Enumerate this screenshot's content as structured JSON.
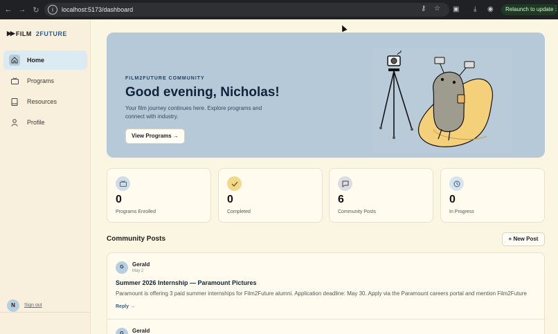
{
  "browser": {
    "url": "localhost:5173/dashboard",
    "relaunch_label": "Relaunch to update"
  },
  "sidebar": {
    "logo_left": "FILM",
    "logo_right": "2FUTURE",
    "items": [
      {
        "label": "Home",
        "icon": "home-icon",
        "active": true
      },
      {
        "label": "Programs",
        "icon": "tv-icon",
        "active": false
      },
      {
        "label": "Resources",
        "icon": "book-icon",
        "active": false
      },
      {
        "label": "Profile",
        "icon": "person-icon",
        "active": false
      }
    ],
    "user_initial": "N",
    "signout_label": "Sign out"
  },
  "hero": {
    "eyebrow": "FILM2FUTURE COMMUNITY",
    "greeting": "Good evening, Nicholas!",
    "subtitle": "Your film journey continues here. Explore programs and connect with industry.",
    "cta": "View Programs →"
  },
  "stats": [
    {
      "value": "0",
      "label": "Programs Enrolled",
      "icon": "tv-icon",
      "icon_bg": "#cfdde8"
    },
    {
      "value": "0",
      "label": "Completed",
      "icon": "check-icon",
      "icon_bg": "#f2d98a"
    },
    {
      "value": "6",
      "label": "Community Posts",
      "icon": "chat-icon",
      "icon_bg": "#dcdde3"
    },
    {
      "value": "0",
      "label": "In Progress",
      "icon": "clock-icon",
      "icon_bg": "#d6e4ee"
    }
  ],
  "posts_section": {
    "title": "Community Posts",
    "new_post_label": "+ New Post"
  },
  "posts": [
    {
      "initial": "G",
      "author": "Gerald",
      "date": "May 2",
      "title": "Summer 2026 Internship — Paramount Pictures",
      "body": "Paramount is offering 3 paid summer internships for Film2Future alumni. Application deadline: May 30. Apply via the Paramount careers portal and mention Film2Future",
      "reply_label": "Reply →"
    },
    {
      "initial": "G",
      "author": "Gerald"
    }
  ]
}
